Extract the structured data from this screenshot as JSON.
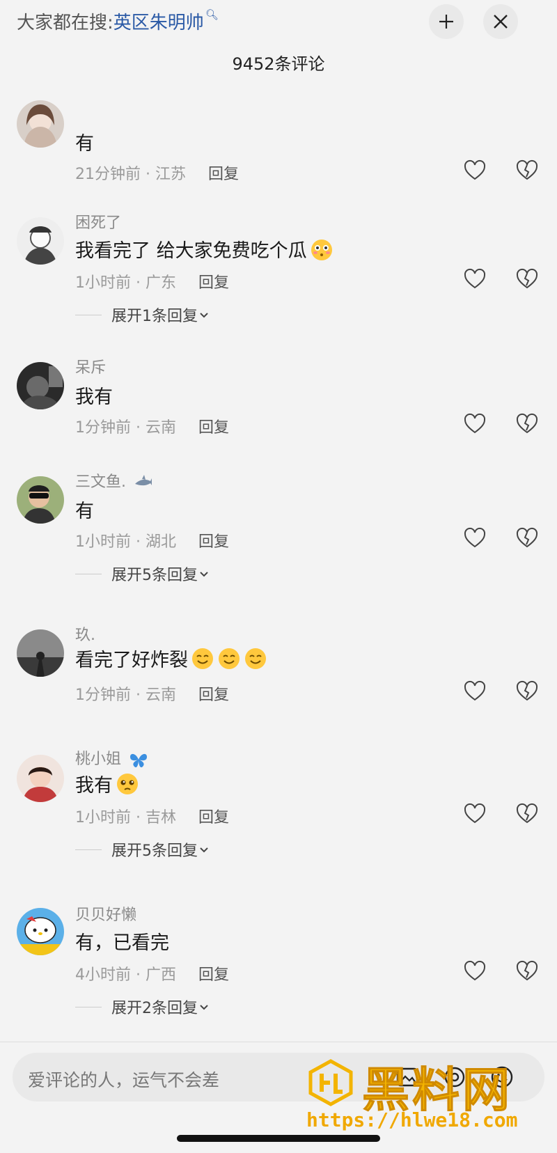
{
  "header": {
    "search_prefix": "大家都在搜:",
    "search_term": "英区朱明帅",
    "comment_count": "9452条评论"
  },
  "comments": [
    {
      "user": "",
      "text": "有",
      "time": "21分钟前 · 江苏",
      "reply": "回复"
    },
    {
      "user": "困死了",
      "text": "我看完了 给大家免费吃个瓜",
      "time": "1小时前 · 广东",
      "reply": "回复",
      "expand": "展开1条回复"
    },
    {
      "user": "呆斥",
      "text": "我有",
      "time": "1分钟前 · 云南",
      "reply": "回复"
    },
    {
      "user": "三文鱼.",
      "text": "有",
      "time": "1小时前 · 湖北",
      "reply": "回复",
      "expand": "展开5条回复"
    },
    {
      "user": "玖.",
      "text": "看完了好炸裂",
      "time": "1分钟前 · 云南",
      "reply": "回复"
    },
    {
      "user": "桃小姐",
      "text": "我有",
      "time": "1小时前 · 吉林",
      "reply": "回复",
      "expand": "展开5条回复"
    },
    {
      "user": "贝贝好懒",
      "text": "有，已看完",
      "time": "4小时前 · 广西",
      "reply": "回复",
      "expand": "展开2条回复"
    }
  ],
  "input": {
    "placeholder": "爱评论的人，运气不会差"
  },
  "watermark": {
    "title": "黑料网",
    "url": "https://hlwe18.com"
  },
  "colors": {
    "search_term": "#2b5aa6",
    "watermark": "#f3b400",
    "background": "#f3f3f3"
  }
}
